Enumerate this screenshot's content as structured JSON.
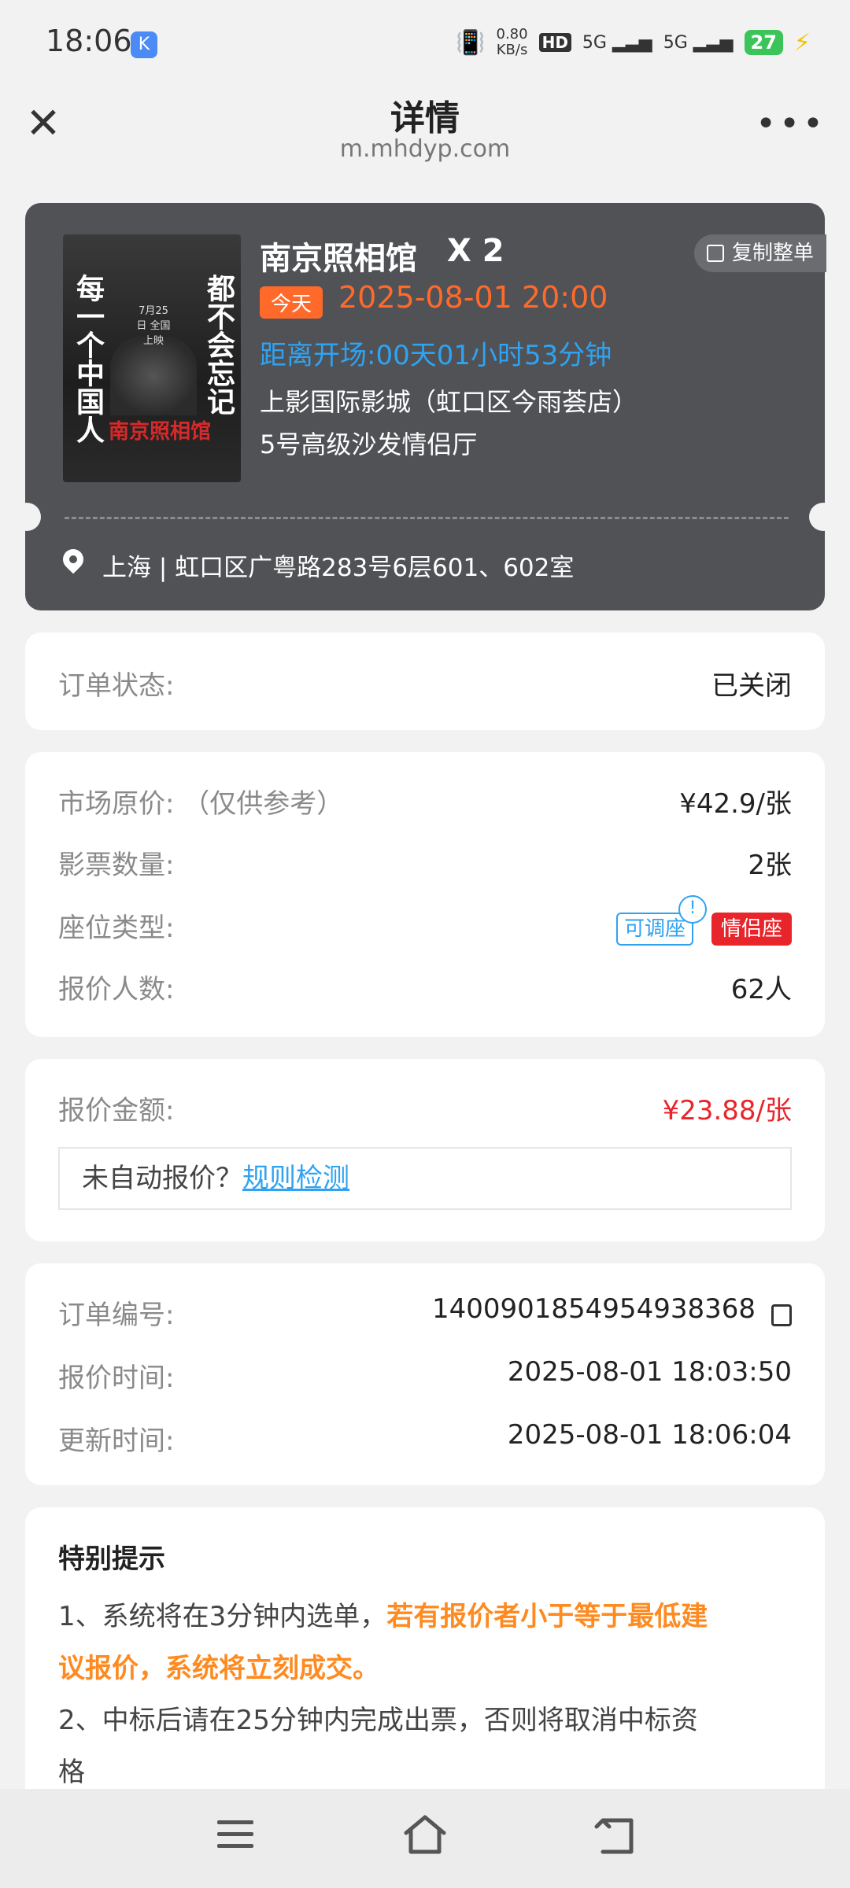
{
  "status_bar": {
    "time": "18:06",
    "app_icon": "K",
    "net_speed_top": "0.80",
    "net_speed_bottom": "KB/s",
    "hd": "HD",
    "sig1": "5G",
    "sig2": "5G",
    "battery": "27"
  },
  "nav": {
    "title": "详情",
    "url": "m.mhdyp.com"
  },
  "ticket": {
    "poster": {
      "left_text": "每一个中国人",
      "right_text": "都不会忘记",
      "release": "7月25日 全国上映",
      "film_name": "南京照相馆"
    },
    "movie_title": "南京照相馆",
    "quantity": "X 2",
    "copy_label": "复制整单",
    "today_tag": "今天",
    "showtime": "2025-08-01 20:00",
    "countdown": "距离开场:00天01小时53分钟",
    "cinema": "上影国际影城（虹口区今雨荟店）",
    "hall": "5号高级沙发情侣厅",
    "address": "上海 | 虹口区广粤路283号6层601、602室"
  },
  "order_status": {
    "label": "订单状态:",
    "value": "已关闭"
  },
  "price_info": {
    "market_label": "市场原价: （仅供参考）",
    "market_value": "¥42.9/张",
    "qty_label": "影票数量:",
    "qty_value": "2张",
    "seat_label": "座位类型:",
    "seat_tag_adjustable": "可调座",
    "seat_tag_couple": "情侣座",
    "info_badge": "!",
    "bidders_label": "报价人数:",
    "bidders_value": "62人"
  },
  "quote": {
    "label": "报价金额:",
    "value": "¥23.88/张",
    "rule_prefix": "未自动报价？",
    "rule_link": "规则检测"
  },
  "order_meta": {
    "order_no_label": "订单编号:",
    "order_no": "1400901854954938368",
    "quote_time_label": "报价时间:",
    "quote_time": "2025-08-01 18:03:50",
    "update_time_label": "更新时间:",
    "update_time": "2025-08-01 18:06:04"
  },
  "notice": {
    "title": "特别提示",
    "line1_prefix": "1、系统将在3分钟内选单，",
    "line1_highlight_a": "若有报价者小于等于最低建",
    "line1_highlight_b": "议报价，系统将立刻成交。",
    "line2_a": "2、中标后请在25分钟内完成出票，否则将取消中标资",
    "line2_b": "格"
  }
}
